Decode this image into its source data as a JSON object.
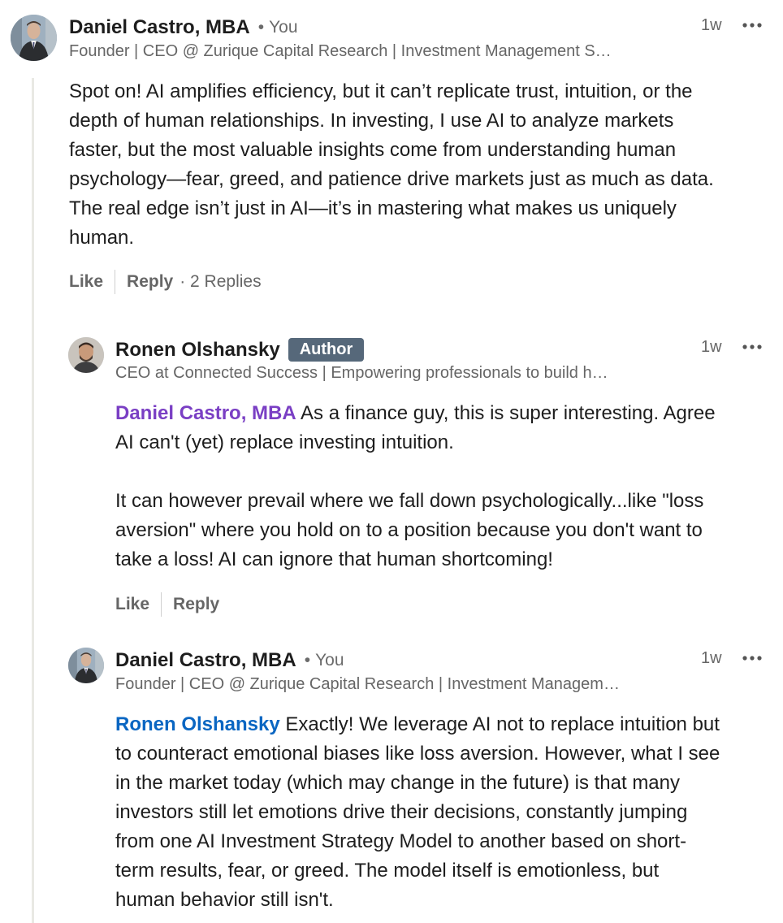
{
  "comments": [
    {
      "author": "Daniel Castro, MBA",
      "you_label": "You",
      "headline": "Founder | CEO @ Zurique Capital Research | Investment Management S…",
      "time": "1w",
      "text_lines": [
        "Spot on! AI amplifies efficiency, but it can’t replicate trust, intuition, or the",
        "depth of human relationships. In investing, I use AI to analyze markets",
        "faster, but the most valuable insights come from understanding human",
        "psychology—fear, greed, and patience drive markets just as much as data.",
        "The real edge isn’t just in AI—it’s in mastering what makes us uniquely",
        "human."
      ],
      "like_label": "Like",
      "reply_label": "Reply",
      "replies_count": "· 2 Replies",
      "more_icon": "ellipsis-icon"
    },
    {
      "author": "Ronen Olshansky",
      "badge": "Author",
      "headline": "CEO at Connected Success | Empowering professionals to build h…",
      "time": "1w",
      "mention": "Daniel Castro, MBA",
      "mention_color": "#7a3fc4",
      "text_line1_rest": " As a finance guy, this is super interesting. Agree",
      "text_line2": "AI can't (yet) replace investing intuition.",
      "text_p2_lines": [
        "It can however prevail where we fall down psychologically...like \"loss",
        "aversion\" where you hold on to a position because you don't want to",
        "take a loss! AI can ignore that human shortcoming!"
      ],
      "like_label": "Like",
      "reply_label": "Reply",
      "more_icon": "ellipsis-icon"
    },
    {
      "author": "Daniel Castro, MBA",
      "you_label": "You",
      "headline": "Founder | CEO @ Zurique Capital Research | Investment Managem…",
      "time": "1w",
      "mention": "Ronen Olshansky",
      "mention_color": "#0a66c2",
      "text_line1_rest": " Exactly! We leverage AI not to replace intuition but",
      "text_lines_rest": [
        "to counteract emotional biases like loss aversion. However, what I see",
        "in the market today (which may change in the future) is that many",
        "investors still let emotions drive their decisions, constantly jumping",
        "from one AI Investment Strategy Model to another based on short-",
        "term results, fear, or greed. The model itself is emotionless, but",
        "human behavior still isn't."
      ],
      "more_icon": "ellipsis-icon"
    }
  ],
  "colors": {
    "badge_bg": "#56687a",
    "thread_line": "#e9e9e4",
    "secondary_text": "#666666"
  }
}
